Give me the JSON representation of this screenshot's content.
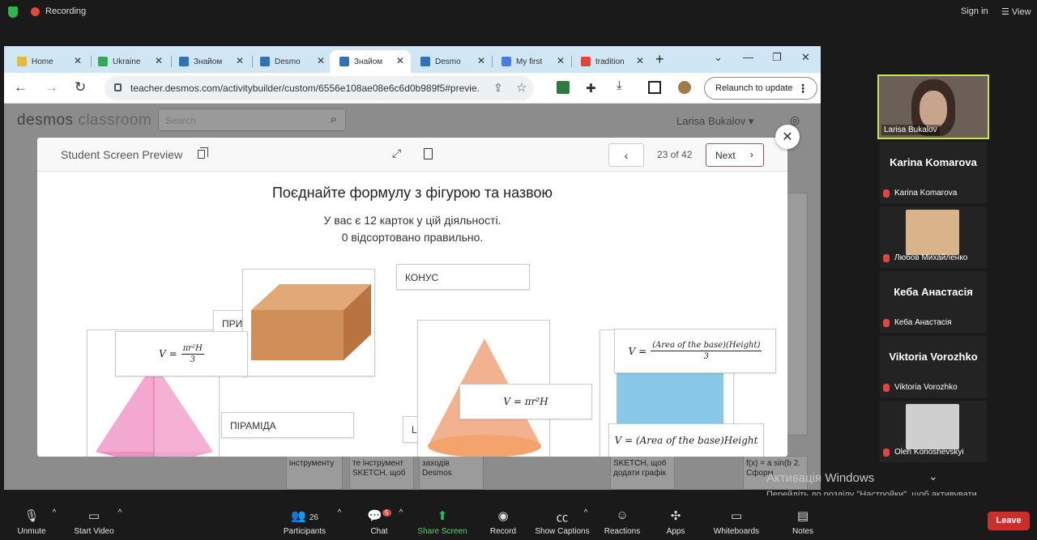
{
  "zoom_top": {
    "recording_label": "Recording",
    "sign_in": "Sign in",
    "view": "View"
  },
  "browser": {
    "tabs": [
      {
        "label": "Home",
        "favicon_color": "#e8b83a"
      },
      {
        "label": "Ukraine",
        "favicon_color": "#34a853"
      },
      {
        "label": "Знайом",
        "favicon_color": "#2f72b8"
      },
      {
        "label": "Desmo",
        "favicon_color": "#2f72b8"
      },
      {
        "label": "Знайом",
        "favicon_color": "#2f72b8"
      },
      {
        "label": "Desmo",
        "favicon_color": "#2f72b8"
      },
      {
        "label": "My first",
        "favicon_color": "#4a7ce8"
      },
      {
        "label": "tradition",
        "favicon_color": "#ea4335"
      }
    ],
    "url": "teacher.desmos.com/activitybuilder/custom/6556e108ae08e6c6d0b989f5#previe...",
    "relaunch_label": "Relaunch to update"
  },
  "desmos": {
    "logo_main": "desmos",
    "logo_sub": "classroom",
    "search_placeholder": "Search",
    "user_name": "Larisa Bukalov",
    "bg_cards": [
      "інструменту",
      "те інструмент SKETCH, щоб",
      "заходів Desmos",
      "SKETCH, щоб додати графік",
      "f(x) = a sin(b 2. Сформ"
    ]
  },
  "modal": {
    "title": "Student Screen Preview",
    "page_counter": "23 of 42",
    "next_label": "Next",
    "activity_title": "Поєднайте формулу з фігурою та назвою",
    "subtitle_line1": "У вас є 12 карток у цій діяльності.",
    "subtitle_line2": "0 відсортовано правильно.",
    "cards": {
      "cone_label": "КОНУС",
      "prism_label_partial": "ПРИ",
      "pyramid_label": "ПІРАМІДА",
      "partial_label": "L",
      "formula_cone_v": "V =",
      "formula_cone_num": "πr²H",
      "formula_cone_den": "3",
      "formula_cyl": "V = πr²H",
      "formula_pyr_v": "V =",
      "formula_pyr_num": "(Area of the base)(Height)",
      "formula_pyr_den": "3",
      "formula_prism": "V = (Area of the base)Height"
    }
  },
  "participants": {
    "self_name": "Larisa Bukalov",
    "list": [
      {
        "big": "Karina Komarova",
        "small": "Karina Komarova",
        "photo": false
      },
      {
        "big": "",
        "small": "Любов Михайленко",
        "photo": true,
        "photo_color": "#d9b48a"
      },
      {
        "big": "Кеба Анастасія",
        "small": "Кеба Анастасія",
        "photo": false
      },
      {
        "big": "Viktoria Vorozhko",
        "small": "Viktoria Vorozhko",
        "photo": false
      },
      {
        "big": "",
        "small": "Oleh Konoshevskyi",
        "photo": true,
        "photo_color": "#cfcfcf"
      }
    ]
  },
  "windows": {
    "activation_title": "Активація Windows",
    "activation_text": "Перейдіть до розділу \"Настройки\", щоб активувати Windows."
  },
  "zoom_bottom": {
    "unmute": "Unmute",
    "start_video": "Start Video",
    "participants": "Participants",
    "participants_count": "26",
    "chat": "Chat",
    "chat_badge": "5",
    "share_screen": "Share Screen",
    "record": "Record",
    "show_captions": "Show Captions",
    "reactions": "Reactions",
    "apps": "Apps",
    "whiteboards": "Whiteboards",
    "notes": "Notes",
    "leave": "Leave"
  }
}
